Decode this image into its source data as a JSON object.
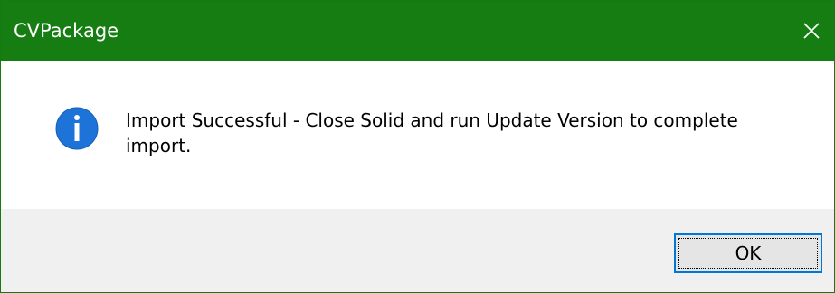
{
  "window": {
    "title": "CVPackage",
    "close_icon": "close-icon",
    "accent_color": "#157d12"
  },
  "message": {
    "icon": "info-icon",
    "text": "Import Successful - Close Solid and run Update Version to complete import."
  },
  "buttons": {
    "ok_label": "OK"
  }
}
